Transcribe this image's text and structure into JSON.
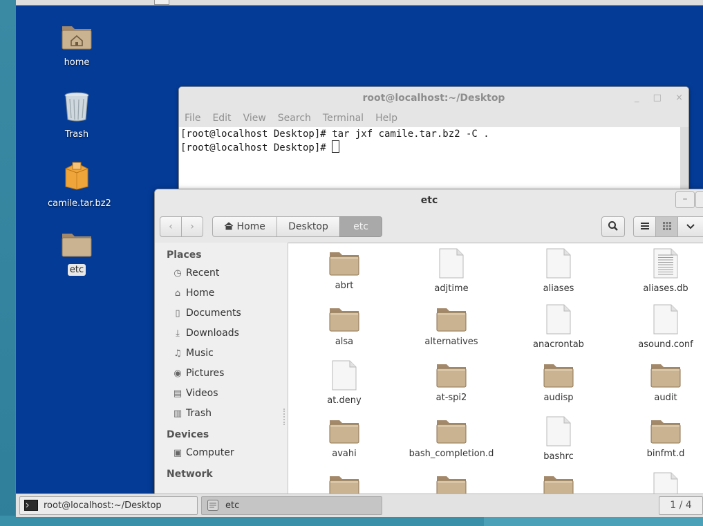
{
  "desktop": {
    "icons": [
      {
        "label": "home",
        "icon": "home-folder-icon"
      },
      {
        "label": "Trash",
        "icon": "trash-icon"
      },
      {
        "label": "camile.tar.bz2",
        "icon": "archive-icon"
      },
      {
        "label": "etc",
        "icon": "folder-icon"
      }
    ]
  },
  "terminal": {
    "title": "root@localhost:~/Desktop",
    "menu": [
      "File",
      "Edit",
      "View",
      "Search",
      "Terminal",
      "Help"
    ],
    "lines": [
      "[root@localhost Desktop]# tar jxf camile.tar.bz2 -C .",
      "[root@localhost Desktop]# "
    ],
    "window_buttons": {
      "minimize": "_",
      "maximize": "□",
      "close": "×"
    }
  },
  "files": {
    "title": "etc",
    "breadcrumb": [
      "Home",
      "Desktop",
      "etc"
    ],
    "sidebar": {
      "places_heading": "Places",
      "places": [
        {
          "label": "Recent",
          "icon": "clock-icon"
        },
        {
          "label": "Home",
          "icon": "home-icon"
        },
        {
          "label": "Documents",
          "icon": "document-icon"
        },
        {
          "label": "Downloads",
          "icon": "download-icon"
        },
        {
          "label": "Music",
          "icon": "music-icon"
        },
        {
          "label": "Pictures",
          "icon": "camera-icon"
        },
        {
          "label": "Videos",
          "icon": "film-icon"
        },
        {
          "label": "Trash",
          "icon": "trash-icon"
        }
      ],
      "devices_heading": "Devices",
      "devices": [
        {
          "label": "Computer",
          "icon": "drive-icon"
        }
      ],
      "network_heading": "Network"
    },
    "items": [
      {
        "name": "abrt",
        "type": "folder"
      },
      {
        "name": "adjtime",
        "type": "file"
      },
      {
        "name": "aliases",
        "type": "file"
      },
      {
        "name": "aliases.db",
        "type": "text"
      },
      {
        "name": "alsa",
        "type": "folder"
      },
      {
        "name": "alternatives",
        "type": "folder"
      },
      {
        "name": "anacrontab",
        "type": "file"
      },
      {
        "name": "asound.conf",
        "type": "file"
      },
      {
        "name": "at.deny",
        "type": "file"
      },
      {
        "name": "at-spi2",
        "type": "folder"
      },
      {
        "name": "audisp",
        "type": "folder"
      },
      {
        "name": "audit",
        "type": "folder"
      },
      {
        "name": "avahi",
        "type": "folder"
      },
      {
        "name": "bash_completion.d",
        "type": "folder"
      },
      {
        "name": "bashrc",
        "type": "file"
      },
      {
        "name": "binfmt.d",
        "type": "folder"
      },
      {
        "name": "",
        "type": "folder"
      },
      {
        "name": "",
        "type": "folder"
      },
      {
        "name": "",
        "type": "folder"
      },
      {
        "name": "",
        "type": "file"
      }
    ]
  },
  "taskbar": {
    "tasks": [
      {
        "label": "root@localhost:~/Desktop",
        "icon": "terminal-icon"
      },
      {
        "label": "etc",
        "icon": "file-manager-icon"
      }
    ],
    "pager": "1 / 4"
  },
  "colors": {
    "desktop": "#043b97",
    "folder": "#b59b73",
    "vm_frame": "#3c8ba5"
  }
}
